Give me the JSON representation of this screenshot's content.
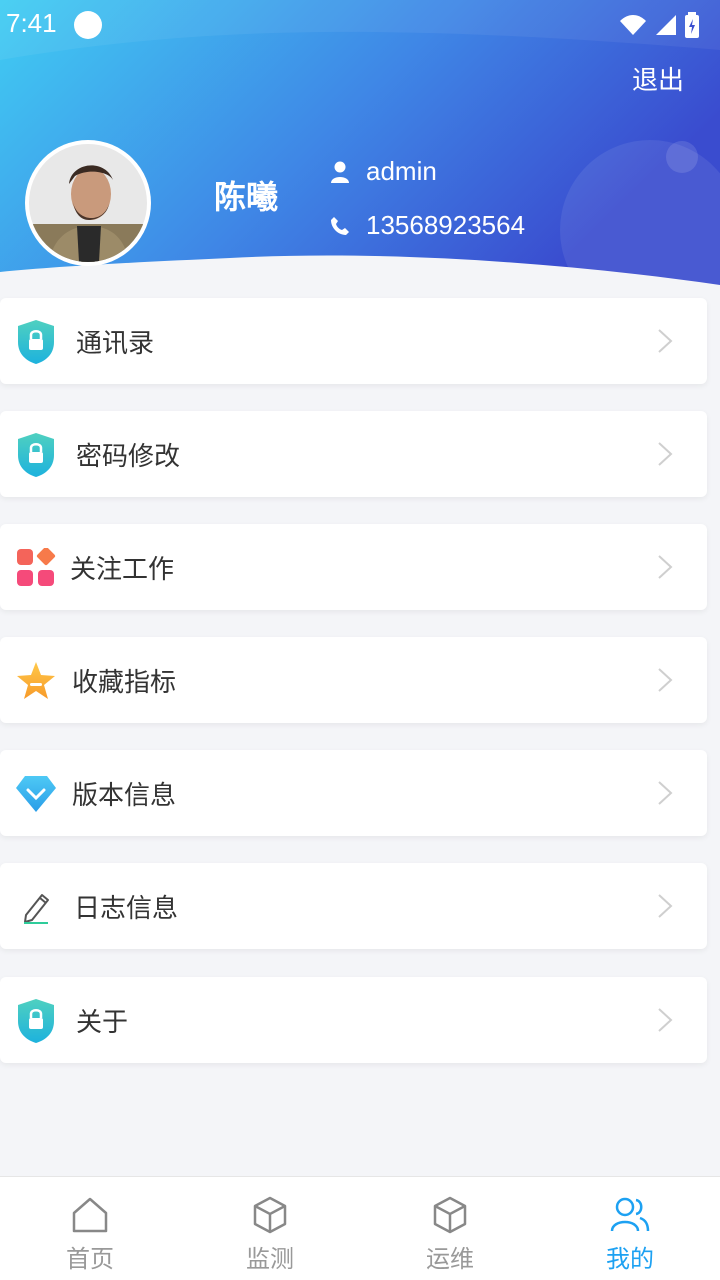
{
  "status_bar": {
    "time": "7:41"
  },
  "header": {
    "logout_label": "退出",
    "user_name": "陈曦",
    "account": "admin",
    "phone": "13568923564"
  },
  "menu": {
    "items": [
      {
        "label": "通讯录",
        "icon": "shield-lock-icon"
      },
      {
        "label": "密码修改",
        "icon": "shield-lock-icon"
      },
      {
        "label": "关注工作",
        "icon": "apps-grid-icon"
      },
      {
        "label": "收藏指标",
        "icon": "star-icon"
      },
      {
        "label": "版本信息",
        "icon": "diamond-icon"
      },
      {
        "label": "日志信息",
        "icon": "pencil-icon"
      },
      {
        "label": "关于",
        "icon": "shield-lock-icon"
      }
    ]
  },
  "bottom_nav": {
    "items": [
      {
        "label": "首页",
        "icon": "home-icon",
        "active": false
      },
      {
        "label": "监测",
        "icon": "cube-icon",
        "active": false
      },
      {
        "label": "运维",
        "icon": "cube-icon",
        "active": false
      },
      {
        "label": "我的",
        "icon": "users-icon",
        "active": true
      }
    ]
  },
  "colors": {
    "accent": "#1da1f2",
    "header_gradient_start": "#3fc8f2",
    "header_gradient_end": "#3a4fd0"
  }
}
